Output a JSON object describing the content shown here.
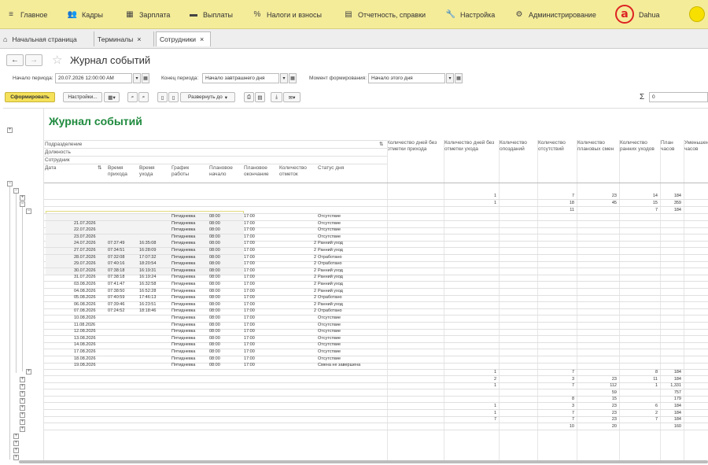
{
  "menu": [
    {
      "label": "Главное",
      "icon": "hamburger-icon"
    },
    {
      "label": "Кадры",
      "icon": "people-icon"
    },
    {
      "label": "Зарплата",
      "icon": "calculator-icon"
    },
    {
      "label": "Выплаты",
      "icon": "cash-icon"
    },
    {
      "label": "Налоги и взносы",
      "icon": "percent-icon"
    },
    {
      "label": "Отчетность, справки",
      "icon": "report-icon"
    },
    {
      "label": "Настройка",
      "icon": "wrench-icon"
    },
    {
      "label": "Администрирование",
      "icon": "gear-icon"
    }
  ],
  "brand": {
    "logo": "a",
    "name": "Dahua"
  },
  "tabs": [
    {
      "label": "Начальная страница"
    },
    {
      "label": "Терминалы",
      "close": "×"
    },
    {
      "label": "Сотрудники",
      "close": "×"
    }
  ],
  "nav": {
    "back": "←",
    "forward": "→",
    "star": "☆"
  },
  "doc_title": "Журнал событий",
  "params": {
    "period_start_label": "Начало периода:",
    "period_start_value": "20.07.2026 12:00:00 AM",
    "period_end_label": "Конец периода:",
    "period_end_value": "Начало завтрашнего дня",
    "moment_label": "Момент формирования:",
    "moment_value": "Начало этого дня"
  },
  "toolbar": {
    "generate": "Сформировать",
    "settings": "Настройки...",
    "expand": "Развернуть до",
    "sigma": "Σ",
    "sum_value": "0"
  },
  "report": {
    "title": "Журнал событий",
    "group_headers": [
      "Подразделение",
      "Должность",
      "Сотрудник"
    ],
    "detail_headers": [
      "Дата",
      "Время прихода",
      "Время ухода",
      "График работы",
      "Плановое начало",
      "Плановое окончание",
      "Количество отметок",
      "Статус дня"
    ],
    "sum_headers": [
      "Количество дней без отметки прихода",
      "Количество дней без отметки ухода",
      "Количество опозданий",
      "Количество отсутствий",
      "Количество плановых смен",
      "Количество ранних уходов",
      "План часов",
      "Уменьшение часов"
    ],
    "top_group_rows": [
      {
        "c1": "",
        "c2": "1",
        "c3": "",
        "c4": "7",
        "c5": "23",
        "c6": "14",
        "c7": "184"
      },
      {
        "c1": "",
        "c2": "1",
        "c3": "",
        "c4": "18",
        "c5": "45",
        "c6": "15",
        "c7": "359"
      },
      {
        "c1": "",
        "c2": "",
        "c3": "",
        "c4": "11",
        "c5": "",
        "c6": "7",
        "c7": "184"
      }
    ],
    "detail_rows": [
      {
        "date": "",
        "in": "",
        "out": "",
        "sched": "Пятидневка",
        "ps": "08:00",
        "pe": "17:00",
        "cnt": "",
        "status": "Отсутствие"
      },
      {
        "date": "21.07.2026",
        "in": "",
        "out": "",
        "sched": "Пятидневка",
        "ps": "08:00",
        "pe": "17:00",
        "cnt": "",
        "status": "Отсутствие"
      },
      {
        "date": "22.07.2026",
        "in": "",
        "out": "",
        "sched": "Пятидневка",
        "ps": "08:00",
        "pe": "17:00",
        "cnt": "",
        "status": "Отсутствие"
      },
      {
        "date": "23.07.2026",
        "in": "",
        "out": "",
        "sched": "Пятидневка",
        "ps": "08:00",
        "pe": "17:00",
        "cnt": "",
        "status": "Отсутствие"
      },
      {
        "date": "24.07.2026",
        "in": "07:37:49",
        "out": "16:35:08",
        "sched": "Пятидневка",
        "ps": "08:00",
        "pe": "17:00",
        "cnt": "2",
        "status": "Ранний уход"
      },
      {
        "date": "27.07.2026",
        "in": "07:34:51",
        "out": "16:28:09",
        "sched": "Пятидневка",
        "ps": "08:00",
        "pe": "17:00",
        "cnt": "2",
        "status": "Ранний уход"
      },
      {
        "date": "28.07.2026",
        "in": "07:32:08",
        "out": "17:07:32",
        "sched": "Пятидневка",
        "ps": "08:00",
        "pe": "17:00",
        "cnt": "2",
        "status": "Отработано"
      },
      {
        "date": "29.07.2026",
        "in": "07:40:16",
        "out": "18:20:54",
        "sched": "Пятидневка",
        "ps": "08:00",
        "pe": "17:00",
        "cnt": "2",
        "status": "Отработано"
      },
      {
        "date": "30.07.2026",
        "in": "07:38:18",
        "out": "16:19:31",
        "sched": "Пятидневка",
        "ps": "08:00",
        "pe": "17:00",
        "cnt": "2",
        "status": "Ранний уход"
      },
      {
        "date": "31.07.2026",
        "in": "07:38:18",
        "out": "16:19:24",
        "sched": "Пятидневка",
        "ps": "08:00",
        "pe": "17:00",
        "cnt": "2",
        "status": "Ранний уход"
      },
      {
        "date": "03.08.2026",
        "in": "07:41:47",
        "out": "16:32:58",
        "sched": "Пятидневка",
        "ps": "08:00",
        "pe": "17:00",
        "cnt": "2",
        "status": "Ранний уход"
      },
      {
        "date": "04.08.2026",
        "in": "07:38:50",
        "out": "16:52:28",
        "sched": "Пятидневка",
        "ps": "08:00",
        "pe": "17:00",
        "cnt": "2",
        "status": "Ранний уход"
      },
      {
        "date": "05.08.2026",
        "in": "07:40:59",
        "out": "17:46:13",
        "sched": "Пятидневка",
        "ps": "08:00",
        "pe": "17:00",
        "cnt": "2",
        "status": "Отработано"
      },
      {
        "date": "06.08.2026",
        "in": "07:39:46",
        "out": "16:23:51",
        "sched": "Пятидневка",
        "ps": "08:00",
        "pe": "17:00",
        "cnt": "2",
        "status": "Ранний уход"
      },
      {
        "date": "07.08.2026",
        "in": "07:24:52",
        "out": "18:18:46",
        "sched": "Пятидневка",
        "ps": "08:00",
        "pe": "17:00",
        "cnt": "2",
        "status": "Отработано"
      },
      {
        "date": "10.08.2026",
        "in": "",
        "out": "",
        "sched": "Пятидневка",
        "ps": "08:00",
        "pe": "17:00",
        "cnt": "",
        "status": "Отсутствие"
      },
      {
        "date": "11.08.2026",
        "in": "",
        "out": "",
        "sched": "Пятидневка",
        "ps": "08:00",
        "pe": "17:00",
        "cnt": "",
        "status": "Отсутствие"
      },
      {
        "date": "12.08.2026",
        "in": "",
        "out": "",
        "sched": "Пятидневка",
        "ps": "08:00",
        "pe": "17:00",
        "cnt": "",
        "status": "Отсутствие"
      },
      {
        "date": "13.08.2026",
        "in": "",
        "out": "",
        "sched": "Пятидневка",
        "ps": "08:00",
        "pe": "17:00",
        "cnt": "",
        "status": "Отсутствие"
      },
      {
        "date": "14.08.2026",
        "in": "",
        "out": "",
        "sched": "Пятидневка",
        "ps": "08:00",
        "pe": "17:00",
        "cnt": "",
        "status": "Отсутствие"
      },
      {
        "date": "17.08.2026",
        "in": "",
        "out": "",
        "sched": "Пятидневка",
        "ps": "08:00",
        "pe": "17:00",
        "cnt": "",
        "status": "Отсутствие"
      },
      {
        "date": "18.08.2026",
        "in": "",
        "out": "",
        "sched": "Пятидневка",
        "ps": "08:00",
        "pe": "17:00",
        "cnt": "",
        "status": "Отсутствие"
      },
      {
        "date": "19.08.2026",
        "in": "",
        "out": "",
        "sched": "Пятидневка",
        "ps": "08:00",
        "pe": "17:00",
        "cnt": "",
        "status": "Смена не завершена"
      }
    ],
    "bottom_group_rows": [
      {
        "c1": "",
        "c2": "1",
        "c3": "",
        "c4": "7",
        "c5": "",
        "c6": "8",
        "c7": "184"
      },
      {
        "c1": "",
        "c2": "2",
        "c3": "",
        "c4": "3",
        "c5": "23",
        "c6": "11",
        "c7": "184"
      },
      {
        "c1": "",
        "c2": "1",
        "c3": "",
        "c4": "7",
        "c5": "112",
        "c6": "1",
        "c7": "1,331"
      },
      {
        "c1": "",
        "c2": "",
        "c3": "",
        "c4": "",
        "c5": "59",
        "c6": "",
        "c7": "757"
      },
      {
        "c1": "",
        "c2": "",
        "c3": "",
        "c4": "8",
        "c5": "15",
        "c6": "",
        "c7": "179"
      },
      {
        "c1": "",
        "c2": "1",
        "c3": "",
        "c4": "3",
        "c5": "23",
        "c6": "6",
        "c7": "184"
      },
      {
        "c1": "",
        "c2": "1",
        "c3": "",
        "c4": "7",
        "c5": "23",
        "c6": "2",
        "c7": "184"
      },
      {
        "c1": "",
        "c2": "7",
        "c3": "",
        "c4": "7",
        "c5": "23",
        "c6": "7",
        "c7": "184"
      },
      {
        "c1": "",
        "c2": "",
        "c3": "",
        "c4": "10",
        "c5": "20",
        "c6": "",
        "c7": "160"
      }
    ]
  }
}
